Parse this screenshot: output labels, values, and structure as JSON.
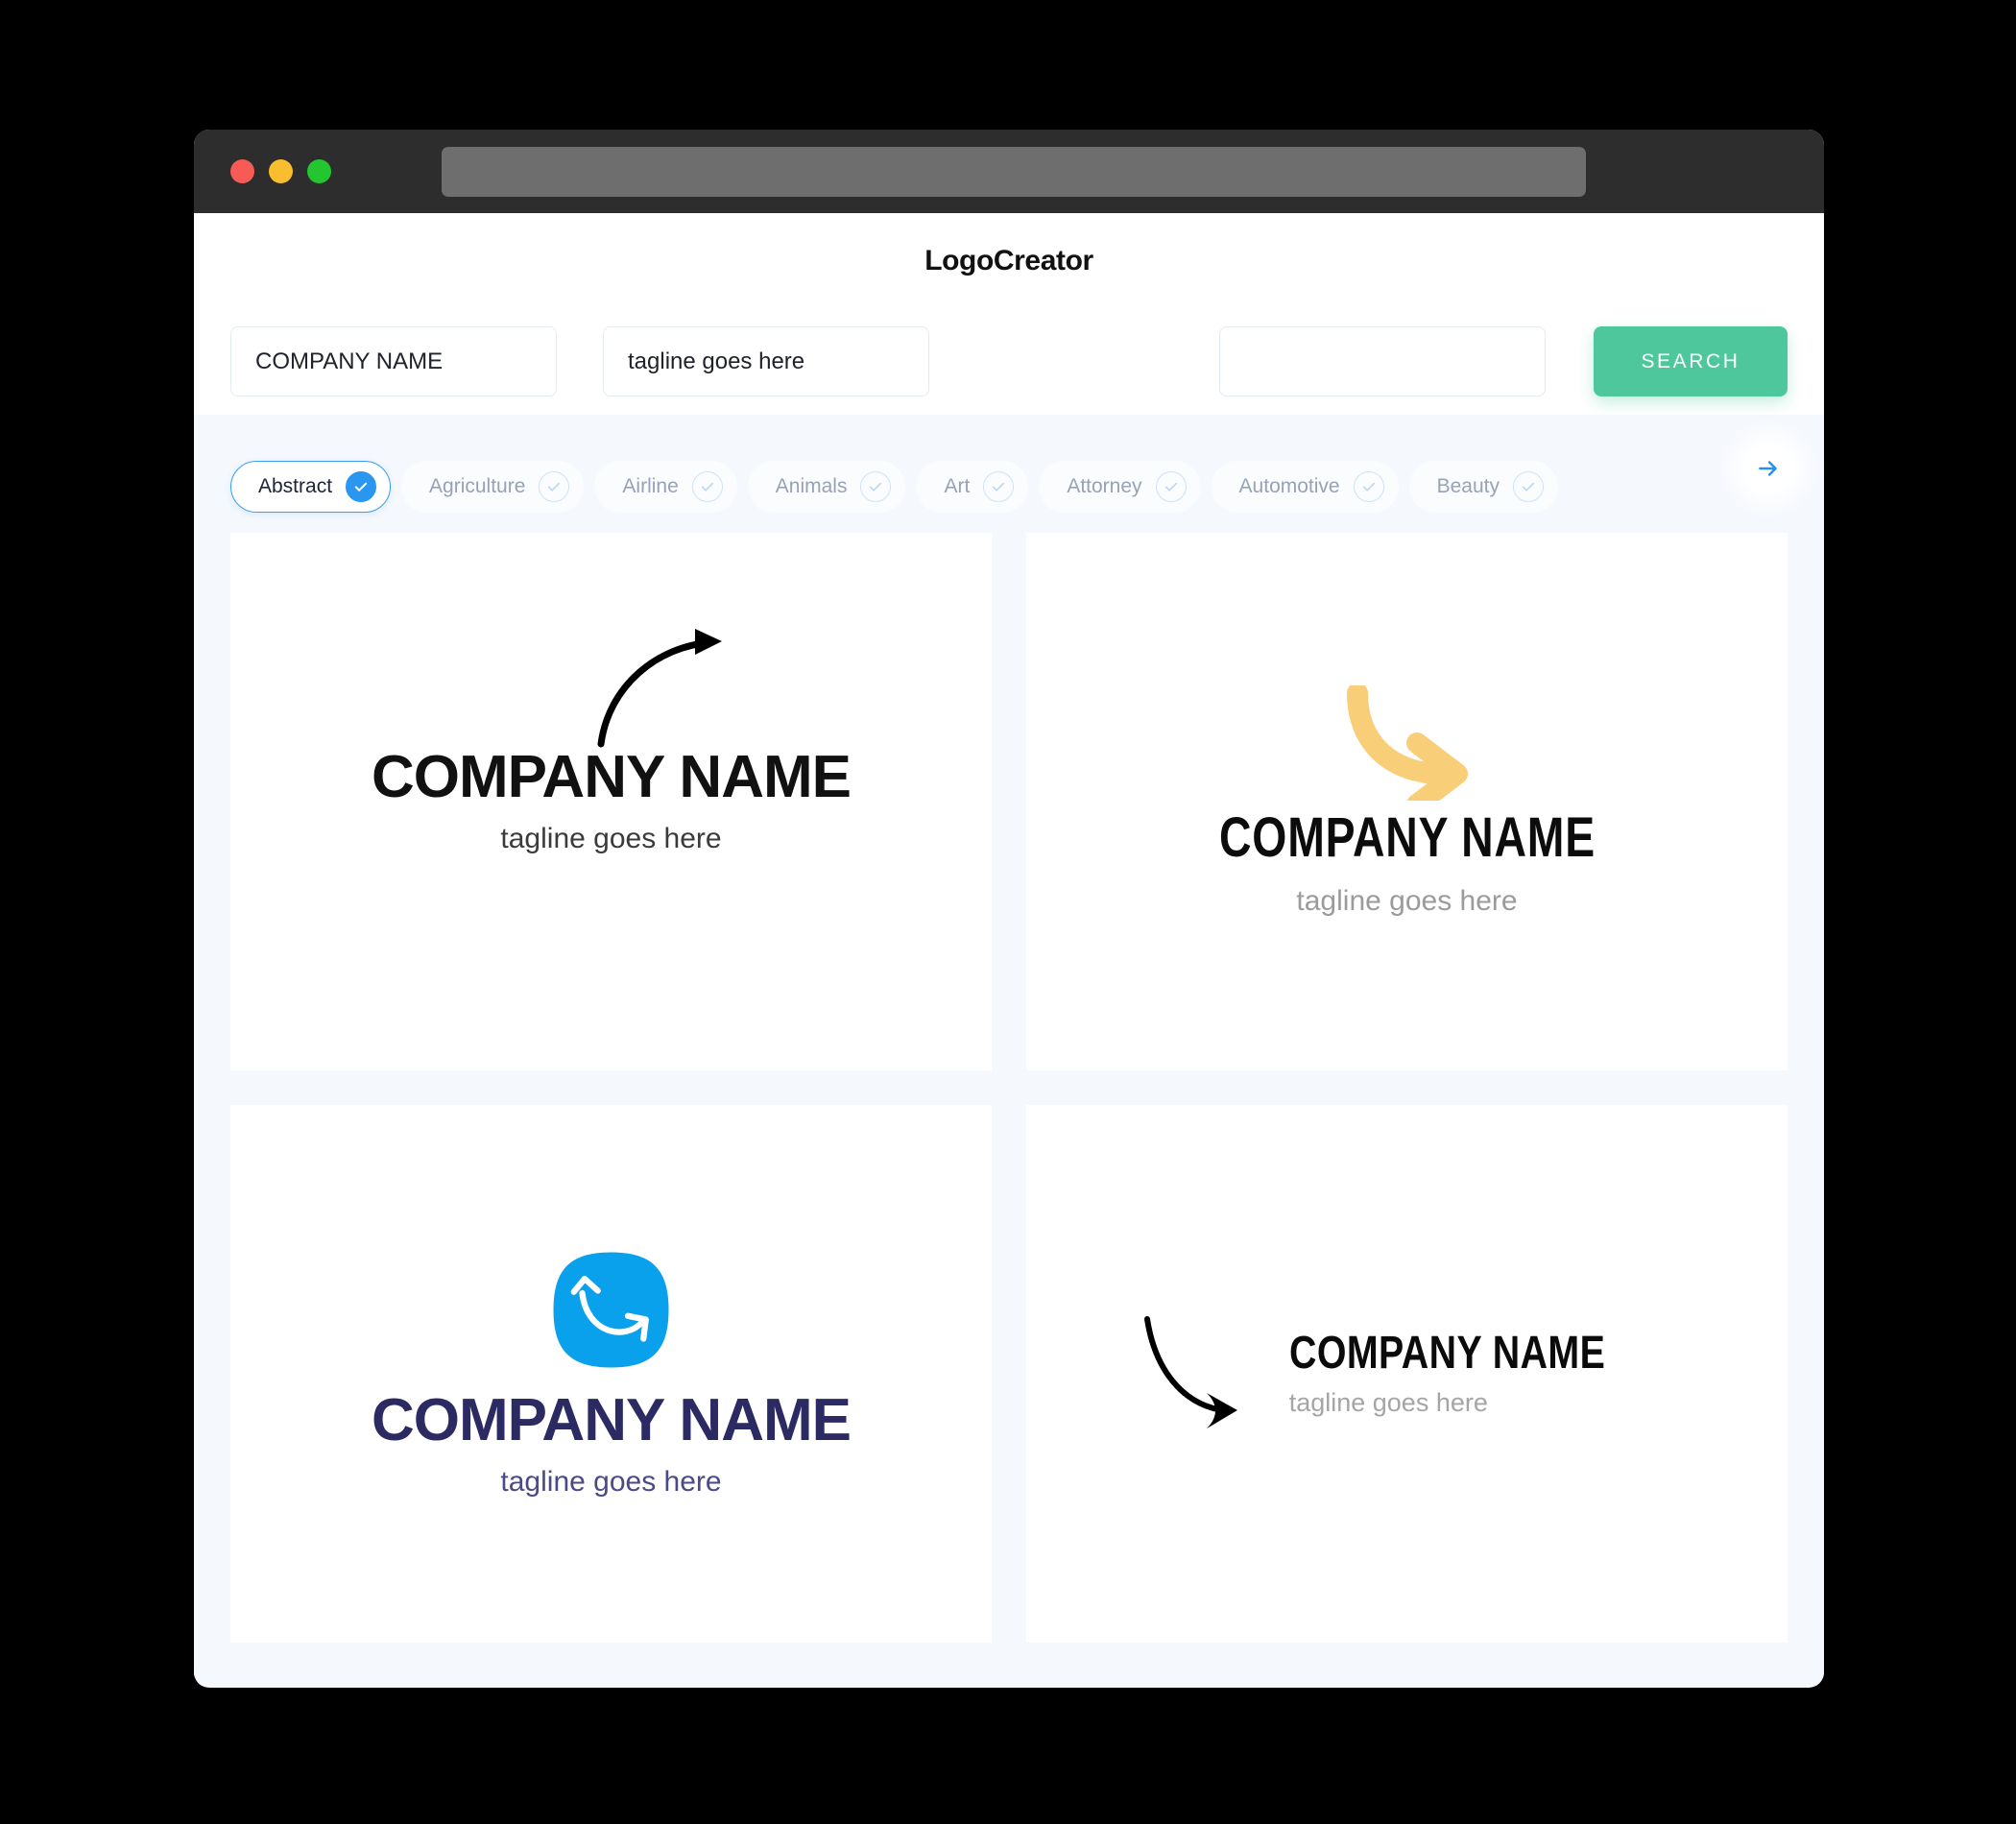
{
  "window": {
    "traffic_lights": [
      {
        "name": "close",
        "color": "#F85B55"
      },
      {
        "name": "minimize",
        "color": "#F9BD2E"
      },
      {
        "name": "maximize",
        "color": "#24C62F"
      }
    ],
    "url_value": ""
  },
  "header": {
    "app_title": "LogoCreator"
  },
  "search": {
    "company_value": "COMPANY NAME",
    "company_placeholder": "COMPANY NAME",
    "tagline_value": "tagline goes here",
    "tagline_placeholder": "tagline goes here",
    "extra_value": "",
    "extra_placeholder": "",
    "search_label": "SEARCH",
    "search_color": "#4FC79D"
  },
  "categories": {
    "accent_color": "#2B96F0",
    "next_label": "→",
    "items": [
      {
        "label": "Abstract",
        "selected": true
      },
      {
        "label": "Agriculture",
        "selected": false
      },
      {
        "label": "Airline",
        "selected": false
      },
      {
        "label": "Animals",
        "selected": false
      },
      {
        "label": "Art",
        "selected": false
      },
      {
        "label": "Attorney",
        "selected": false
      },
      {
        "label": "Automotive",
        "selected": false
      },
      {
        "label": "Beauty",
        "selected": false
      }
    ]
  },
  "results": [
    {
      "id": "logo-1",
      "name": "COMPANY NAME",
      "tagline": "tagline goes here",
      "name_color": "#111111",
      "tagline_color": "#3B3B3B",
      "ornament": "curved-arrow-up-right",
      "ornament_color": "#000000"
    },
    {
      "id": "logo-2",
      "name": "COMPANY NAME",
      "tagline": "tagline goes here",
      "name_color": "#0C0C0C",
      "tagline_color": "#9B9B9B",
      "ornament": "curved-arrow-down-right",
      "ornament_color": "#F9CE78"
    },
    {
      "id": "logo-3",
      "name": "COMPANY NAME",
      "tagline": "tagline goes here",
      "name_color": "#2B2A63",
      "tagline_color": "#4B4A86",
      "ornament": "squircle-double-arrow",
      "ornament_color": "#0AA1EC"
    },
    {
      "id": "logo-4",
      "name": "COMPANY NAME",
      "tagline": "tagline goes here",
      "name_color": "#0B0B0B",
      "tagline_color": "#A5A5A5",
      "ornament": "descending-arrow-right",
      "ornament_color": "#000000"
    }
  ]
}
